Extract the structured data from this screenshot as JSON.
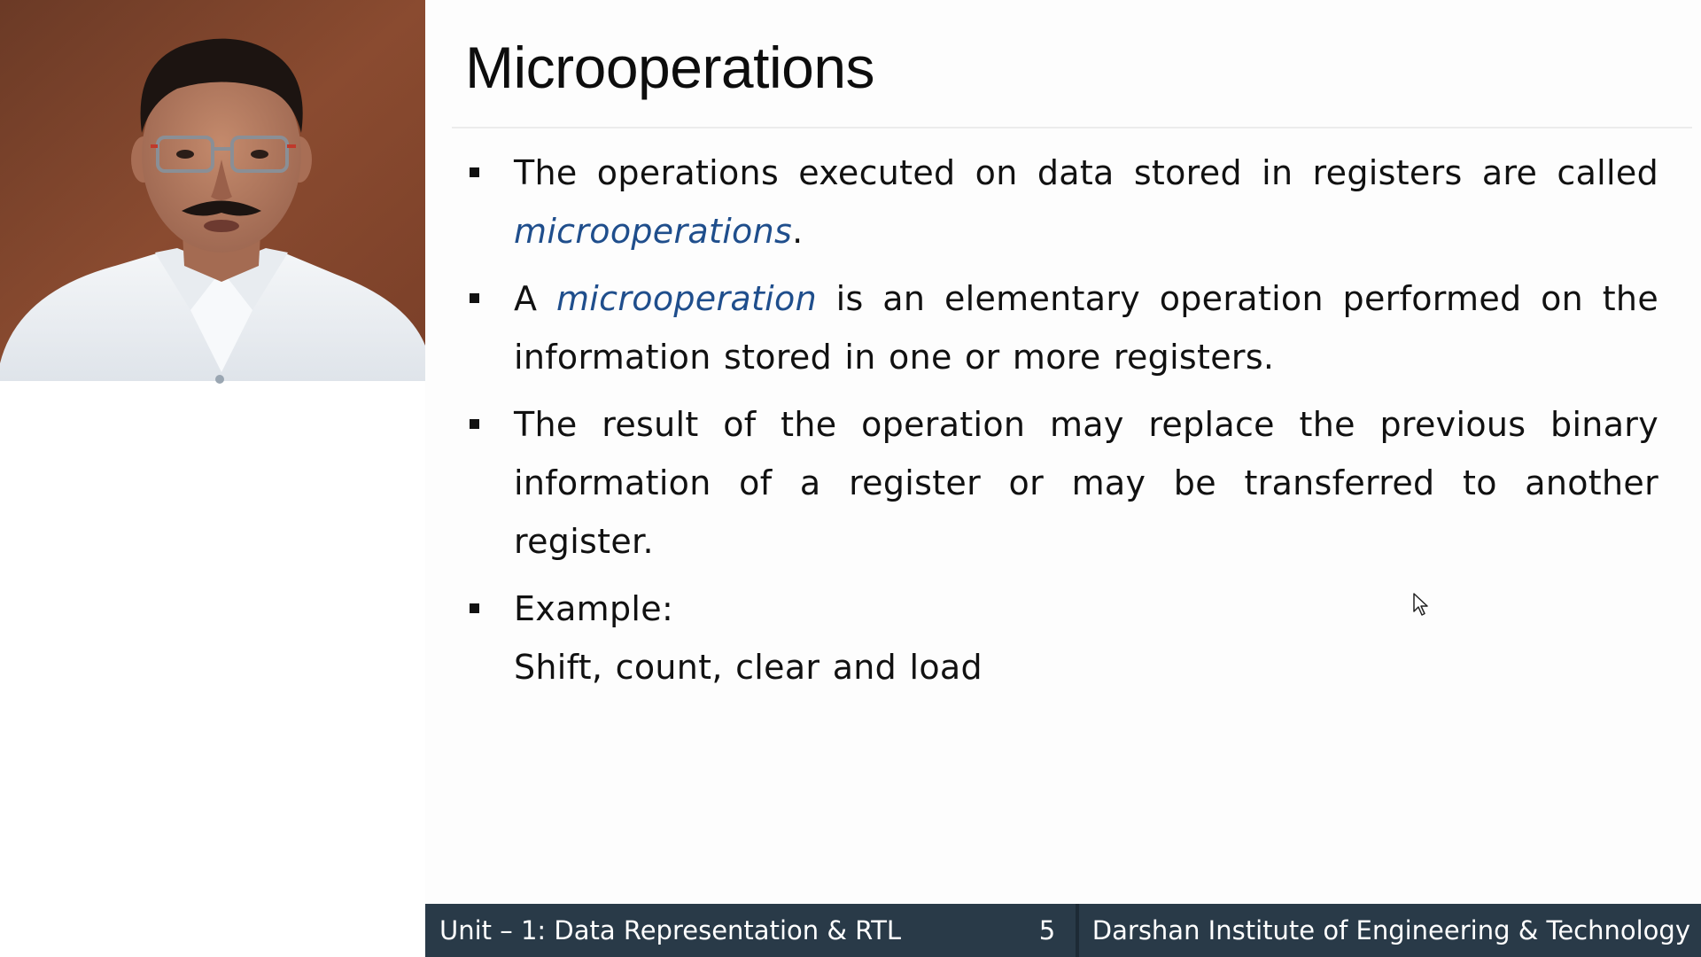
{
  "slide": {
    "title": "Microoperations",
    "bullets": [
      {
        "before": "The operations executed on data stored in registers are called ",
        "emphasis": "microoperations",
        "after": "."
      },
      {
        "before": "A ",
        "emphasis": "microoperation",
        "after": " is an elementary operation performed on the information stored in one or more registers."
      },
      {
        "text": "The result of the operation may replace the previous binary information of a register or may be transferred to another register."
      },
      {
        "text": "Example:",
        "sub_text": "Shift, count, clear and load"
      }
    ]
  },
  "footer": {
    "unit": "Unit – 1: Data Representation & RTL",
    "page_number": "5",
    "institute": "Darshan Institute of Engineering & Technology"
  },
  "colors": {
    "footer_bg": "#293a48",
    "emphasis_text": "#1f4e8c",
    "body_text": "#111111"
  }
}
